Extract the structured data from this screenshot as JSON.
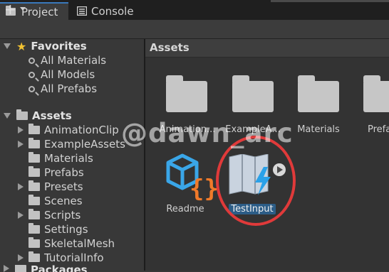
{
  "tabs": [
    {
      "label": "Project",
      "icon": "folder-icon",
      "active": true
    },
    {
      "label": "Console",
      "icon": "console-icon",
      "active": false
    }
  ],
  "toolbar": {
    "add_label": "+"
  },
  "favorites": {
    "label": "Favorites",
    "items": [
      {
        "label": "All Materials"
      },
      {
        "label": "All Models"
      },
      {
        "label": "All Prefabs"
      }
    ]
  },
  "assets_tree": {
    "label": "Assets",
    "items": [
      {
        "label": "AnimationClip",
        "expandable": true
      },
      {
        "label": "ExampleAssets",
        "expandable": true
      },
      {
        "label": "Materials",
        "expandable": false
      },
      {
        "label": "Prefabs",
        "expandable": false
      },
      {
        "label": "Presets",
        "expandable": true
      },
      {
        "label": "Scenes",
        "expandable": false
      },
      {
        "label": "Scripts",
        "expandable": true
      },
      {
        "label": "Settings",
        "expandable": false
      },
      {
        "label": "SkeletalMesh",
        "expandable": false
      },
      {
        "label": "TutorialInfo",
        "expandable": true
      }
    ],
    "packages_label": "Packages"
  },
  "assets_panel": {
    "title": "Assets",
    "grid": [
      {
        "label": "Animation...",
        "icon": "folder-icon"
      },
      {
        "label": "ExampleA...",
        "icon": "folder-icon"
      },
      {
        "label": "Materials",
        "icon": "folder-icon"
      },
      {
        "label": "Prefa",
        "icon": "folder-icon"
      },
      {
        "label": "Readme",
        "icon": "readme-icon"
      },
      {
        "label": "TestInput",
        "icon": "input-actions-icon",
        "selected": true
      }
    ]
  },
  "watermark": "@dawn_arc",
  "colors": {
    "selection": "#2c5d87",
    "ring": "#e03a3a",
    "star": "#f2c232",
    "accent_blue": "#3aa6e8",
    "accent_orange": "#f07a2a"
  }
}
